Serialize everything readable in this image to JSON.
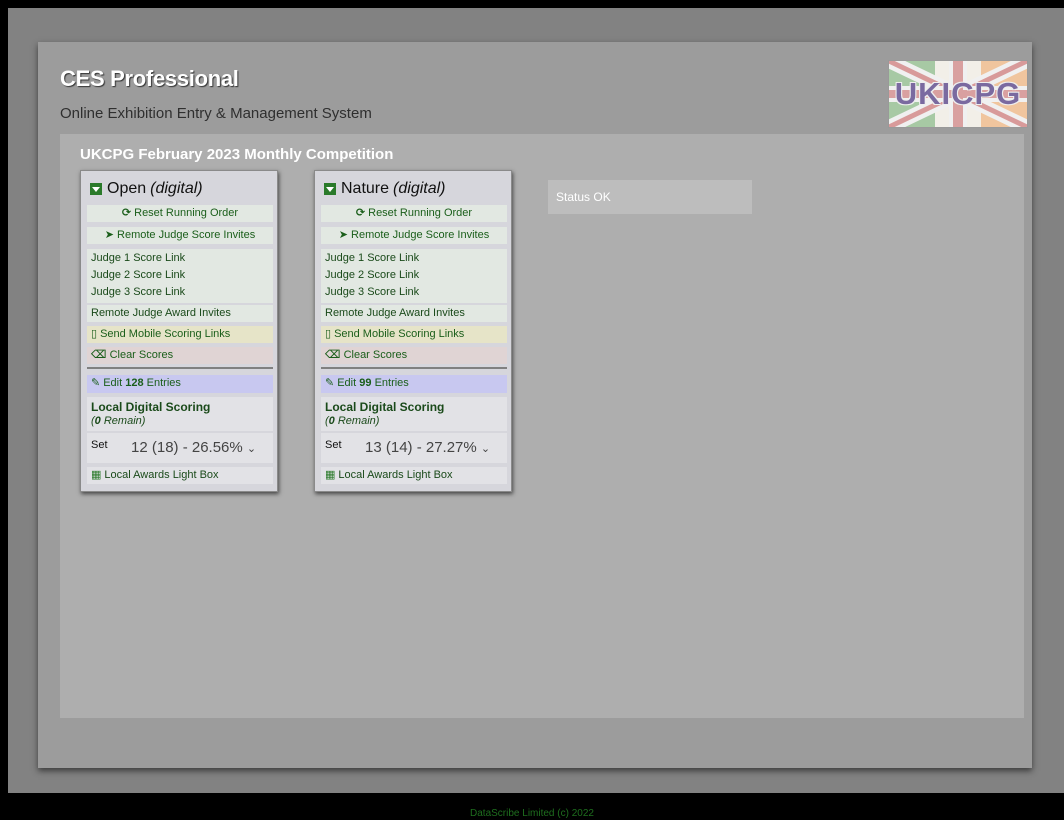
{
  "header": {
    "title": "CES Professional",
    "subtitle": "Online Exhibition Entry & Management System",
    "logo_text": "UKICPG"
  },
  "competition": {
    "title": "UKCPG February 2023 Monthly Competition"
  },
  "status": {
    "text": "Status OK"
  },
  "sections": [
    {
      "name": "Open",
      "kind": "(digital)",
      "reset_running_order": "Reset Running Order",
      "remote_judge_score_invites": "Remote Judge Score Invites",
      "judge_links": [
        "Judge 1 Score Link",
        "Judge 2 Score Link",
        "Judge 3 Score Link"
      ],
      "remote_judge_award_invites": "Remote Judge Award Invites",
      "send_mobile_scoring_links": "Send Mobile Scoring Links",
      "clear_scores": "Clear Scores",
      "edit_prefix": "Edit",
      "entries_count": "128",
      "edit_suffix": "Entries",
      "local_digital_scoring": "Local Digital Scoring",
      "remain_count": "0",
      "remain_label": "Remain)",
      "remain_open": "(",
      "set_label": "Set",
      "set_value": "12 (18) - 26.56%",
      "local_awards_light_box": "Local Awards Light Box"
    },
    {
      "name": "Nature",
      "kind": "(digital)",
      "reset_running_order": "Reset Running Order",
      "remote_judge_score_invites": "Remote Judge Score Invites",
      "judge_links": [
        "Judge 1 Score Link",
        "Judge 2 Score Link",
        "Judge 3 Score Link"
      ],
      "remote_judge_award_invites": "Remote Judge Award Invites",
      "send_mobile_scoring_links": "Send Mobile Scoring Links",
      "clear_scores": "Clear Scores",
      "edit_prefix": "Edit",
      "entries_count": "99",
      "edit_suffix": "Entries",
      "local_digital_scoring": "Local Digital Scoring",
      "remain_count": "0",
      "remain_label": "Remain)",
      "remain_open": "(",
      "set_label": "Set",
      "set_value": "13 (14) - 27.27%",
      "local_awards_light_box": "Local Awards Light Box"
    }
  ],
  "footer": {
    "text": "DataScribe Limited (c) 2022"
  },
  "colors": {
    "link_green": "#1a5e1a",
    "toggle_green": "#2a7a2a"
  },
  "icons": {
    "reset": "refresh-icon",
    "invite": "send-icon",
    "mobile": "mobile-icon",
    "clear": "backspace-icon",
    "edit": "edit-icon",
    "lightbox": "grid-icon"
  }
}
